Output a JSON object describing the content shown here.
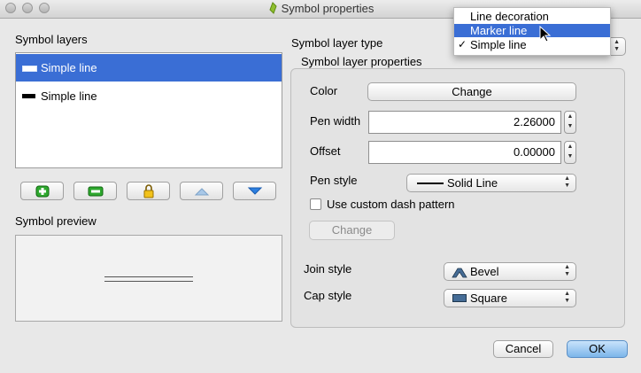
{
  "window": {
    "title": "Symbol properties",
    "icon": "qgis-icon"
  },
  "layers": {
    "label": "Symbol layers",
    "items": [
      {
        "label": "Simple line",
        "swatch_color": "#ffffff",
        "selected": true
      },
      {
        "label": "Simple line",
        "swatch_color": "#000000",
        "selected": false
      }
    ],
    "buttons": [
      "add-layer-icon",
      "remove-layer-icon",
      "lock-icon",
      "move-up-icon",
      "move-down-icon"
    ]
  },
  "preview": {
    "label": "Symbol preview"
  },
  "layer_type": {
    "label": "Symbol layer type",
    "options": [
      "Line decoration",
      "Marker line",
      "Simple line"
    ],
    "highlighted": "Marker line",
    "checked": "Simple line"
  },
  "props": {
    "group_title": "Symbol layer properties",
    "color_label": "Color",
    "color_button": "Change",
    "pen_width_label": "Pen width",
    "pen_width_value": "2.26000",
    "offset_label": "Offset",
    "offset_value": "0.00000",
    "pen_style_label": "Pen style",
    "pen_style_value": "Solid Line",
    "dash_checkbox_label": "Use custom dash pattern",
    "dash_change_button": "Change",
    "join_style_label": "Join style",
    "join_style_value": "Bevel",
    "cap_style_label": "Cap style",
    "cap_style_value": "Square"
  },
  "footer": {
    "cancel": "Cancel",
    "ok": "OK"
  },
  "colors": {
    "selection": "#3a6ed5",
    "ok_button": "#9cc7f0"
  }
}
